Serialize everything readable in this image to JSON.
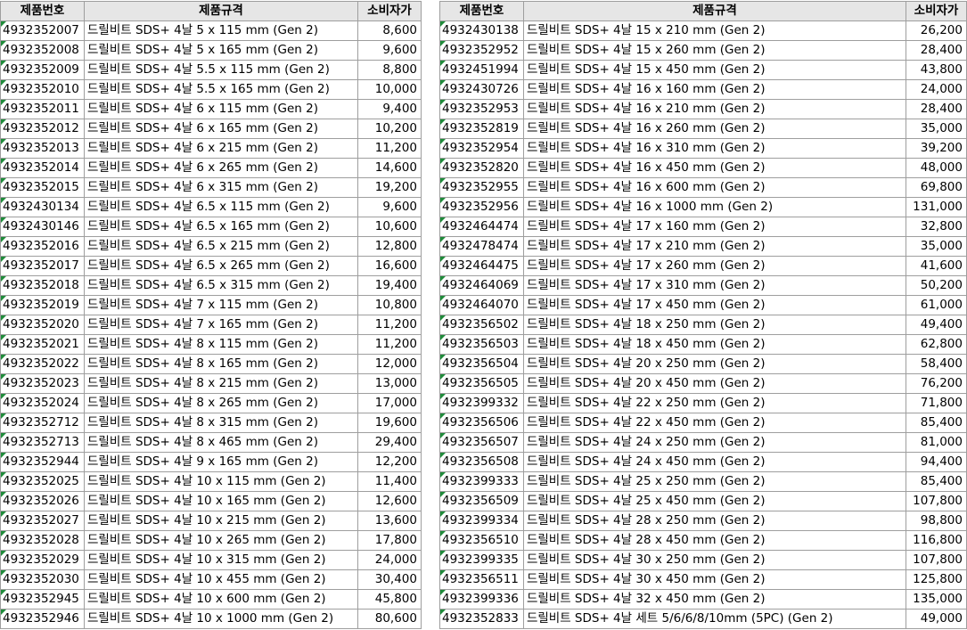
{
  "headers": {
    "code": "제품번호",
    "spec": "제품규격",
    "price": "소비자가"
  },
  "left_rows": [
    [
      "4932352007",
      "드릴비트 SDS+ 4날 5 x 115 mm (Gen 2)",
      "8,600"
    ],
    [
      "4932352008",
      "드릴비트 SDS+ 4날 5 x 165 mm (Gen 2)",
      "9,600"
    ],
    [
      "4932352009",
      "드릴비트 SDS+ 4날 5.5 x 115 mm (Gen 2)",
      "8,800"
    ],
    [
      "4932352010",
      "드릴비트 SDS+ 4날 5.5 x 165 mm (Gen 2)",
      "10,000"
    ],
    [
      "4932352011",
      "드릴비트 SDS+ 4날 6 x 115 mm (Gen 2)",
      "9,400"
    ],
    [
      "4932352012",
      "드릴비트 SDS+ 4날 6 x 165 mm (Gen 2)",
      "10,200"
    ],
    [
      "4932352013",
      "드릴비트 SDS+ 4날 6 x 215 mm (Gen 2)",
      "11,200"
    ],
    [
      "4932352014",
      "드릴비트 SDS+ 4날 6 x 265 mm (Gen 2)",
      "14,600"
    ],
    [
      "4932352015",
      "드릴비트 SDS+ 4날 6 x 315 mm (Gen 2)",
      "19,200"
    ],
    [
      "4932430134",
      "드릴비트 SDS+ 4날 6.5 x 115 mm (Gen 2)",
      "9,600"
    ],
    [
      "4932430146",
      "드릴비트 SDS+ 4날 6.5 x 165 mm (Gen 2)",
      "10,600"
    ],
    [
      "4932352016",
      "드릴비트 SDS+ 4날 6.5 x 215 mm (Gen 2)",
      "12,800"
    ],
    [
      "4932352017",
      "드릴비트 SDS+ 4날 6.5 x 265 mm (Gen 2)",
      "16,600"
    ],
    [
      "4932352018",
      "드릴비트 SDS+ 4날 6.5 x 315 mm (Gen 2)",
      "19,400"
    ],
    [
      "4932352019",
      "드릴비트 SDS+ 4날 7 x 115 mm (Gen 2)",
      "10,800"
    ],
    [
      "4932352020",
      "드릴비트 SDS+ 4날 7 x 165 mm (Gen 2)",
      "11,200"
    ],
    [
      "4932352021",
      "드릴비트 SDS+ 4날 8 x 115 mm (Gen 2)",
      "11,200"
    ],
    [
      "4932352022",
      "드릴비트 SDS+ 4날 8 x 165 mm (Gen 2)",
      "12,000"
    ],
    [
      "4932352023",
      "드릴비트 SDS+ 4날 8 x 215 mm (Gen 2)",
      "13,000"
    ],
    [
      "4932352024",
      "드릴비트 SDS+ 4날 8 x 265 mm (Gen 2)",
      "17,000"
    ],
    [
      "4932352712",
      "드릴비트 SDS+ 4날 8 x 315 mm (Gen 2)",
      "19,600"
    ],
    [
      "4932352713",
      "드릴비트 SDS+ 4날 8 x 465 mm (Gen 2)",
      "29,400"
    ],
    [
      "4932352944",
      "드릴비트 SDS+ 4날 9 x 165 mm (Gen 2)",
      "12,200"
    ],
    [
      "4932352025",
      "드릴비트 SDS+ 4날 10 x 115 mm (Gen 2)",
      "11,400"
    ],
    [
      "4932352026",
      "드릴비트 SDS+ 4날 10 x 165 mm (Gen 2)",
      "12,600"
    ],
    [
      "4932352027",
      "드릴비트 SDS+ 4날 10 x 215 mm (Gen 2)",
      "13,600"
    ],
    [
      "4932352028",
      "드릴비트 SDS+ 4날 10 x 265 mm (Gen 2)",
      "17,800"
    ],
    [
      "4932352029",
      "드릴비트 SDS+ 4날 10 x 315 mm (Gen 2)",
      "24,000"
    ],
    [
      "4932352030",
      "드릴비트 SDS+ 4날 10 x 455 mm (Gen 2)",
      "30,400"
    ],
    [
      "4932352945",
      "드릴비트 SDS+ 4날 10 x 600 mm (Gen 2)",
      "45,800"
    ],
    [
      "4932352946",
      "드릴비트 SDS+ 4날 10 x 1000 mm (Gen 2)",
      "80,600"
    ]
  ],
  "right_rows": [
    [
      "4932430138",
      "드릴비트 SDS+ 4날 15 x 210 mm (Gen 2)",
      "26,200"
    ],
    [
      "4932352952",
      "드릴비트 SDS+ 4날 15 x 260 mm (Gen 2)",
      "28,400"
    ],
    [
      "4932451994",
      "드릴비트 SDS+ 4날 15 x 450 mm (Gen 2)",
      "43,800"
    ],
    [
      "4932430726",
      "드릴비트 SDS+ 4날 16 x 160 mm (Gen 2)",
      "24,000"
    ],
    [
      "4932352953",
      "드릴비트 SDS+ 4날 16 x 210 mm (Gen 2)",
      "28,400"
    ],
    [
      "4932352819",
      "드릴비트 SDS+ 4날 16 x 260 mm (Gen 2)",
      "35,000"
    ],
    [
      "4932352954",
      "드릴비트 SDS+ 4날 16 x 310 mm (Gen 2)",
      "39,200"
    ],
    [
      "4932352820",
      "드릴비트 SDS+ 4날 16 x 450 mm (Gen 2)",
      "48,000"
    ],
    [
      "4932352955",
      "드릴비트 SDS+ 4날 16 x 600 mm (Gen 2)",
      "69,800"
    ],
    [
      "4932352956",
      "드릴비트 SDS+ 4날 16 x 1000 mm (Gen 2)",
      "131,000"
    ],
    [
      "4932464474",
      "드릴비트 SDS+ 4날 17 x 160 mm (Gen 2)",
      "32,800"
    ],
    [
      "4932478474",
      "드릴비트 SDS+ 4날 17 x 210 mm (Gen 2)",
      "35,000"
    ],
    [
      "4932464475",
      "드릴비트 SDS+ 4날 17 x 260 mm (Gen 2)",
      "41,600"
    ],
    [
      "4932464069",
      "드릴비트 SDS+ 4날 17 x 310 mm (Gen 2)",
      "50,200"
    ],
    [
      "4932464070",
      "드릴비트 SDS+ 4날 17 x 450 mm (Gen 2)",
      "61,000"
    ],
    [
      "4932356502",
      "드릴비트 SDS+ 4날 18 x 250 mm (Gen 2)",
      "49,400"
    ],
    [
      "4932356503",
      "드릴비트 SDS+ 4날 18 x 450 mm (Gen 2)",
      "62,800"
    ],
    [
      "4932356504",
      "드릴비트 SDS+ 4날 20 x 250 mm (Gen 2)",
      "58,400"
    ],
    [
      "4932356505",
      "드릴비트 SDS+ 4날 20 x 450 mm (Gen 2)",
      "76,200"
    ],
    [
      "4932399332",
      "드릴비트 SDS+ 4날 22 x 250 mm (Gen 2)",
      "71,800"
    ],
    [
      "4932356506",
      "드릴비트 SDS+ 4날 22 x 450 mm (Gen 2)",
      "85,400"
    ],
    [
      "4932356507",
      "드릴비트 SDS+ 4날 24 x 250 mm (Gen 2)",
      "81,000"
    ],
    [
      "4932356508",
      "드릴비트 SDS+ 4날 24 x 450 mm (Gen 2)",
      "94,400"
    ],
    [
      "4932399333",
      "드릴비트 SDS+ 4날 25 x 250 mm (Gen 2)",
      "85,400"
    ],
    [
      "4932356509",
      "드릴비트 SDS+ 4날 25 x 450 mm (Gen 2)",
      "107,800"
    ],
    [
      "4932399334",
      "드릴비트 SDS+ 4날 28 x 250 mm (Gen 2)",
      "98,800"
    ],
    [
      "4932356510",
      "드릴비트 SDS+ 4날 28 x 450 mm (Gen 2)",
      "116,800"
    ],
    [
      "4932399335",
      "드릴비트 SDS+ 4날 30 x 250 mm (Gen 2)",
      "107,800"
    ],
    [
      "4932356511",
      "드릴비트 SDS+ 4날 30 x 450 mm (Gen 2)",
      "125,800"
    ],
    [
      "4932399336",
      "드릴비트 SDS+ 4날 32 x 450 mm (Gen 2)",
      "135,000"
    ],
    [
      "4932352833",
      "드릴비트 SDS+ 4날 세트 5/6/6/8/10mm (5PC) (Gen 2)",
      "49,000"
    ]
  ],
  "colors": {
    "header_bg": "#e6e6e6",
    "grid": "#9e9e9e",
    "cell_marker": "#1f8b3a"
  }
}
